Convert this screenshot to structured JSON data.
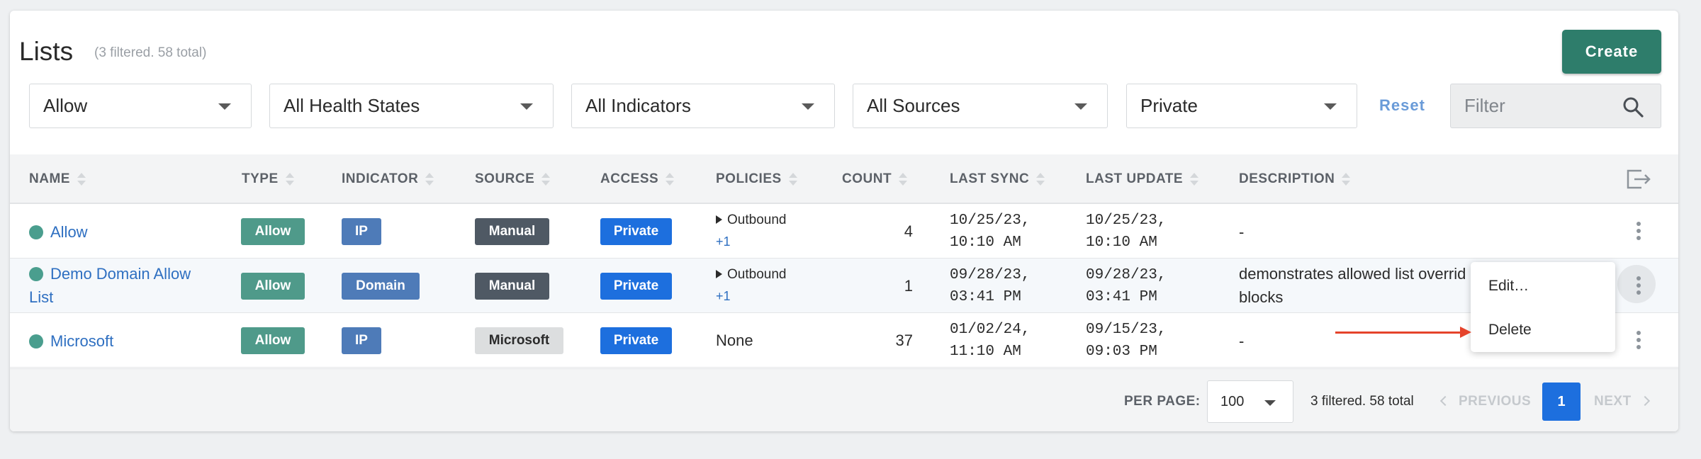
{
  "header": {
    "title": "Lists",
    "subtitle": "(3 filtered. 58 total)",
    "create_label": "Create"
  },
  "filters": {
    "type": "Allow",
    "health": "All Health States",
    "indicators": "All Indicators",
    "sources": "All Sources",
    "access": "Private",
    "reset_label": "Reset",
    "filter_placeholder": "Filter"
  },
  "columns": [
    "NAME",
    "TYPE",
    "INDICATOR",
    "SOURCE",
    "ACCESS",
    "POLICIES",
    "COUNT",
    "LAST SYNC",
    "LAST UPDATE",
    "DESCRIPTION"
  ],
  "rows": [
    {
      "name": "Allow",
      "type": "Allow",
      "indicator": "IP",
      "source": "Manual",
      "access": "Private",
      "policy": "Outbound",
      "policy_more": "+1",
      "count": "4",
      "last_sync_date": "10/25/23,",
      "last_sync_time": "10:10 AM",
      "last_update_date": "10/25/23,",
      "last_update_time": "10:10 AM",
      "description": "-"
    },
    {
      "name": "Demo Domain Allow List",
      "type": "Allow",
      "indicator": "Domain",
      "source": "Manual",
      "access": "Private",
      "policy": "Outbound",
      "policy_more": "+1",
      "count": "1",
      "last_sync_date": "09/28/23,",
      "last_sync_time": "03:41 PM",
      "last_update_date": "09/28/23,",
      "last_update_time": "03:41 PM",
      "description": "demonstrates allowed list overrid blocks"
    },
    {
      "name": "Microsoft",
      "type": "Allow",
      "indicator": "IP",
      "source": "Microsoft",
      "access": "Private",
      "policy_none": "None",
      "count": "37",
      "last_sync_date": "01/02/24,",
      "last_sync_time": "11:10 AM",
      "last_update_date": "09/15/23,",
      "last_update_time": "09:03 PM",
      "description": "-"
    }
  ],
  "context_menu": {
    "edit": "Edit…",
    "delete": "Delete"
  },
  "footer": {
    "per_page_label": "PER PAGE:",
    "per_page_value": "100",
    "total_text": "3 filtered. 58 total",
    "previous": "PREVIOUS",
    "page": "1",
    "next": "NEXT"
  },
  "colors": {
    "accent": "#2e7d6b",
    "link": "#2e6fc1",
    "private_badge": "#1d6fde",
    "annotation_arrow": "#e5432b"
  }
}
